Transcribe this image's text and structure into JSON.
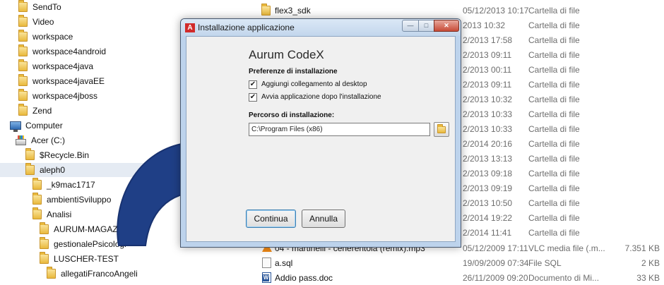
{
  "nav_tree": {
    "items": [
      {
        "label": "SendTo",
        "icon": "folder-icon"
      },
      {
        "label": "Video",
        "icon": "folder-icon"
      },
      {
        "label": "workspace",
        "icon": "folder-icon"
      },
      {
        "label": "workspace4android",
        "icon": "folder-icon"
      },
      {
        "label": "workspace4java",
        "icon": "folder-icon"
      },
      {
        "label": "workspace4javaEE",
        "icon": "folder-icon"
      },
      {
        "label": "workspace4jboss",
        "icon": "folder-icon"
      },
      {
        "label": "Zend",
        "icon": "folder-icon"
      },
      {
        "label": "Computer",
        "icon": "computer-icon"
      },
      {
        "label": "Acer (C:)",
        "icon": "drive-icon"
      },
      {
        "label": "$Recycle.Bin",
        "icon": "folder-icon"
      },
      {
        "label": "aleph0",
        "icon": "folder-icon",
        "selected": true
      },
      {
        "label": "_k9mac1717",
        "icon": "folder-icon"
      },
      {
        "label": "ambientiSviluppo",
        "icon": "folder-icon"
      },
      {
        "label": "Analisi",
        "icon": "folder-icon"
      },
      {
        "label": "AURUM-MAGAZZINO",
        "icon": "folder-icon"
      },
      {
        "label": "gestionalePsicologi",
        "icon": "folder-icon"
      },
      {
        "label": "LUSCHER-TEST",
        "icon": "folder-icon"
      },
      {
        "label": "allegatiFrancoAngeli",
        "icon": "folder-icon"
      }
    ]
  },
  "file_list": {
    "rows": [
      {
        "name": "flex3_sdk",
        "date": "05/12/2013 10:17",
        "type": "Cartella di file",
        "size": ""
      },
      {
        "name": "",
        "date": "2013 10:32",
        "type": "Cartella di file",
        "size": ""
      },
      {
        "name": "",
        "date": "2/2013 17:58",
        "type": "Cartella di file",
        "size": ""
      },
      {
        "name": "",
        "date": "2/2013 09:11",
        "type": "Cartella di file",
        "size": ""
      },
      {
        "name": "",
        "date": "2/2013 00:11",
        "type": "Cartella di file",
        "size": ""
      },
      {
        "name": "",
        "date": "2/2013 09:11",
        "type": "Cartella di file",
        "size": ""
      },
      {
        "name": "",
        "date": "2/2013 10:32",
        "type": "Cartella di file",
        "size": ""
      },
      {
        "name": "",
        "date": "2/2013 10:33",
        "type": "Cartella di file",
        "size": ""
      },
      {
        "name": "",
        "date": "2/2013 10:33",
        "type": "Cartella di file",
        "size": ""
      },
      {
        "name": "",
        "date": "2/2014 20:16",
        "type": "Cartella di file",
        "size": ""
      },
      {
        "name": "",
        "date": "2/2013 13:13",
        "type": "Cartella di file",
        "size": ""
      },
      {
        "name": "",
        "date": "2/2013 09:18",
        "type": "Cartella di file",
        "size": ""
      },
      {
        "name": "",
        "date": "2/2013 09:19",
        "type": "Cartella di file",
        "size": ""
      },
      {
        "name": "",
        "date": "2/2013 10:50",
        "type": "Cartella di file",
        "size": ""
      },
      {
        "name": "",
        "date": "2/2014 19:22",
        "type": "Cartella di file",
        "size": ""
      },
      {
        "name": "",
        "date": "2/2014 11:41",
        "type": "Cartella di file",
        "size": ""
      },
      {
        "name": "04 - martinelli - cenerentola (remix).mp3",
        "date": "05/12/2009 17:11",
        "type": "VLC media file (.m...",
        "size": "7.351 KB",
        "icon": "vlc-icon"
      },
      {
        "name": "a.sql",
        "date": "19/09/2009 07:34",
        "type": "File SQL",
        "size": "2 KB",
        "icon": "sql-file-icon"
      },
      {
        "name": "Addio pass.doc",
        "date": "26/11/2009 09:20",
        "type": "Documento di Mi...",
        "size": "33 KB",
        "icon": "word-doc-icon"
      }
    ]
  },
  "dialog": {
    "title": "Installazione applicazione",
    "app_icon_glyph": "A",
    "app_name": "Aurum CodeX",
    "preferences_heading": "Preferenze di installazione",
    "options": [
      {
        "label": "Aggiungi collegamento al desktop",
        "checked": true
      },
      {
        "label": "Avvia applicazione dopo l'installazione",
        "checked": true
      }
    ],
    "path_heading": "Percorso di installazione:",
    "path_value": "C:\\Program Files (x86)",
    "continue_label": "Continua",
    "cancel_label": "Annulla",
    "window_buttons": {
      "minimize": "—",
      "maximize": "□",
      "close": "✕"
    }
  },
  "colors": {
    "arrow": "#1f3f86",
    "dialog_frame": "#bdd3ec",
    "tree_selection": "#e5ebf3"
  }
}
